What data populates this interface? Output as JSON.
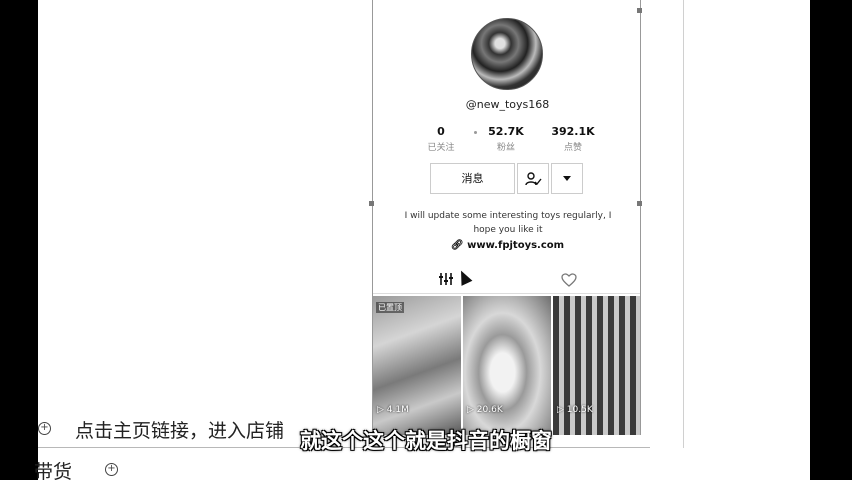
{
  "profile": {
    "username": "@new_toys168",
    "stats": [
      {
        "value": "0",
        "label": "已关注"
      },
      {
        "value": "52.7K",
        "label": "粉丝"
      },
      {
        "value": "392.1K",
        "label": "点赞"
      }
    ],
    "message_button": "消息",
    "follow_icon": "person-check-icon",
    "more_icon": "caret-down-icon",
    "bio": "I will update some interesting toys regularly, I hope you like it",
    "link": "www.fpjtoys.com",
    "link_icon": "link-icon"
  },
  "tabs": {
    "videos_icon": "filter-icon",
    "liked_icon": "heart-icon"
  },
  "videos": [
    {
      "count": "4.1M",
      "badge": "已置顶"
    },
    {
      "count": "20.6K",
      "badge": ""
    },
    {
      "count": "10.5K",
      "badge": ""
    }
  ],
  "document": {
    "line1": "点击主页链接，进入店铺",
    "line2": "带货",
    "bullet_glyph": "⊕"
  },
  "subtitle": "就这个这个就是抖音的橱窗"
}
